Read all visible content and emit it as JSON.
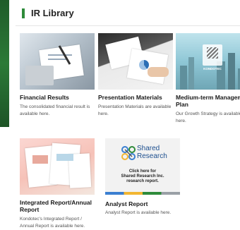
{
  "panel": {
    "title": "IR Library"
  },
  "cards": [
    {
      "title": "Financial Results",
      "desc": "The consolidated financial result is available here.",
      "thumb_icon": "laptop-report-photo"
    },
    {
      "title": "Presentation Materials",
      "desc": "Presentation Materials are available here.",
      "thumb_icon": "handshake-documents-photo"
    },
    {
      "title": "Medium-term Management Plan",
      "desc": "Our Growth Strategy is available here.",
      "thumb_icon": "city-skyline-photo",
      "logo_text": "KONDOTEC"
    },
    {
      "title": "Integrated Report/Annual Report",
      "desc": "Kondotec's Integrated Report / Annual Report is available here.",
      "thumb_icon": "report-booklets-photo"
    },
    {
      "title": "Analyst Report",
      "desc": "Analyst Report is available here.",
      "thumb_icon": "shared-research-logo",
      "logo_line1": "Shared",
      "logo_line2": "Research",
      "banner_line1": "Click here for",
      "banner_line2": "Shared Research Inc.",
      "banner_line3": "research report."
    }
  ],
  "colors": {
    "accent": "#2e8b3a",
    "side_strip": "#2c7a37"
  }
}
